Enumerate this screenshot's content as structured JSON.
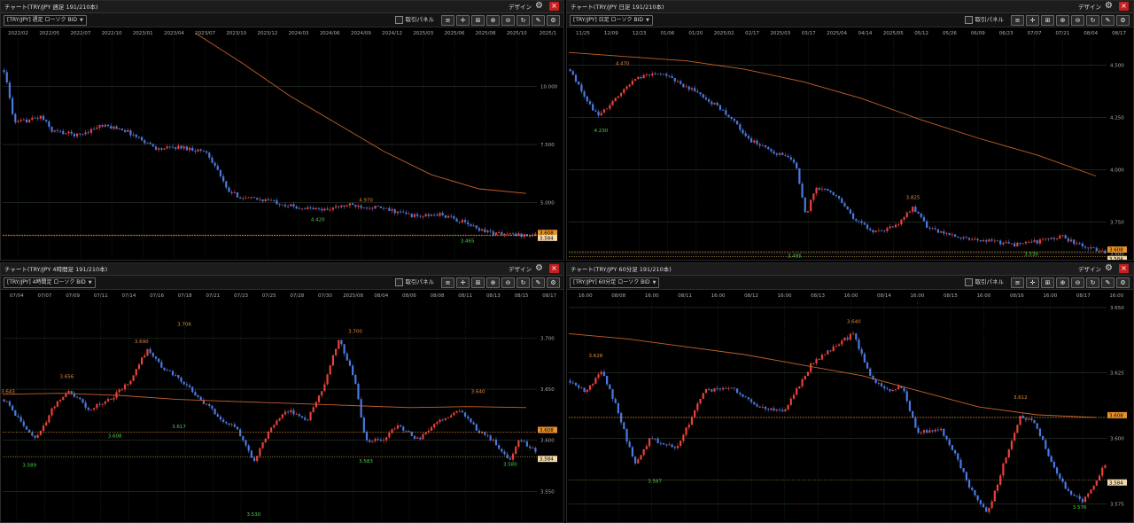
{
  "ui": {
    "design_label": "デザイン",
    "order_panel_label": "取引パネル",
    "close_glyph": "×",
    "caret_glyph": "▼",
    "colors": {
      "bull": "#e8403a",
      "bear": "#4a78e0",
      "ma": "#c8602a",
      "grid": "#1b3a1b",
      "ask_line": "#e8922a",
      "label_bg": "#e8922a",
      "close_button": "#c81e1e"
    }
  },
  "panels": [
    {
      "title": "チャート(TRY/JPY 週足 191/210本)",
      "symbol": "[TRY/JPY] 週足 ローソク BID",
      "chart_data": {
        "type": "candlestick",
        "x_ticks": [
          "2022/02",
          "2022/05",
          "2022/07",
          "2022/10",
          "2023/01",
          "2023/04",
          "2023/07",
          "2023/10",
          "2023/12",
          "2024/03",
          "2024/06",
          "2024/09",
          "2024/12",
          "2025/03",
          "2025/06",
          "2025/08",
          "2025/10",
          "2025/1"
        ],
        "y_ticks": [
          "10.000",
          "7.500",
          "5.000"
        ],
        "ylim": [
          2.55,
          12.0
        ],
        "annotations": [
          {
            "text": "4.970",
            "color": "orange"
          },
          {
            "text": "4.420",
            "color": "green"
          },
          {
            "text": "3.465",
            "color": "green"
          }
        ],
        "price_tags": [
          "3.608",
          "3.584"
        ],
        "price_levels": [
          3.608,
          3.584
        ],
        "path": [
          [
            0,
            10.7
          ],
          [
            0.02,
            8.4
          ],
          [
            0.07,
            8.7
          ],
          [
            0.09,
            8.1
          ],
          [
            0.14,
            7.9
          ],
          [
            0.18,
            8.3
          ],
          [
            0.22,
            8.2
          ],
          [
            0.26,
            7.7
          ],
          [
            0.29,
            7.3
          ],
          [
            0.33,
            7.4
          ],
          [
            0.38,
            7.2
          ],
          [
            0.4,
            6.5
          ],
          [
            0.42,
            5.5
          ],
          [
            0.45,
            5.2
          ],
          [
            0.5,
            5.1
          ],
          [
            0.55,
            4.8
          ],
          [
            0.6,
            4.7
          ],
          [
            0.65,
            4.9
          ],
          [
            0.7,
            4.8
          ],
          [
            0.74,
            4.6
          ],
          [
            0.78,
            4.4
          ],
          [
            0.82,
            4.5
          ],
          [
            0.86,
            4.2
          ],
          [
            0.89,
            3.9
          ],
          [
            0.92,
            3.7
          ],
          [
            0.96,
            3.62
          ],
          [
            1.0,
            3.6
          ]
        ],
        "ma": {
          "x0": 0.36,
          "x1": 0.98,
          "y": [
            12.3,
            11.0,
            9.6,
            8.4,
            7.2,
            6.2,
            5.6,
            5.4
          ]
        },
        "markers": [
          {
            "label": "4.970",
            "lx": 0.68,
            "ly": 5.05,
            "color": "orange"
          },
          {
            "label": "4.420",
            "lx": 0.59,
            "ly": 4.2,
            "color": "green"
          },
          {
            "label": "3.465",
            "lx": 0.87,
            "ly": 3.3,
            "color": "green"
          }
        ]
      }
    },
    {
      "title": "チャート(TRY/JPY 日足 191/210本)",
      "symbol": "[TRY/JPY] 日足 ローソク BID",
      "chart_data": {
        "type": "candlestick",
        "x_ticks": [
          "11/25",
          "12/09",
          "12/23",
          "01/06",
          "01/20",
          "2025/02",
          "02/17",
          "2025/03",
          "03/17",
          "2025/04",
          "04/14",
          "2025/05",
          "05/12",
          "05/26",
          "06/09",
          "06/23",
          "07/07",
          "07/21",
          "08/04",
          "08/17"
        ],
        "y_ticks": [
          "4.500",
          "4.250",
          "4.000",
          "3.750",
          "3.600"
        ],
        "ylim": [
          3.57,
          4.62
        ],
        "annotations": [
          {
            "text": "4.470",
            "color": "orange"
          },
          {
            "text": "4.230",
            "color": "green"
          },
          {
            "text": "3.825",
            "color": "orange"
          },
          {
            "text": "3.495",
            "color": "green"
          },
          {
            "text": "3.530",
            "color": "green"
          }
        ],
        "price_tags": [
          "3.608",
          "3.584"
        ],
        "price_levels": [
          3.608,
          3.584
        ],
        "path": [
          [
            0,
            4.48
          ],
          [
            0.02,
            4.38
          ],
          [
            0.05,
            4.26
          ],
          [
            0.08,
            4.32
          ],
          [
            0.12,
            4.44
          ],
          [
            0.17,
            4.46
          ],
          [
            0.2,
            4.42
          ],
          [
            0.25,
            4.35
          ],
          [
            0.3,
            4.25
          ],
          [
            0.33,
            4.15
          ],
          [
            0.37,
            4.1
          ],
          [
            0.4,
            4.06
          ],
          [
            0.42,
            4.04
          ],
          [
            0.44,
            3.78
          ],
          [
            0.46,
            3.92
          ],
          [
            0.5,
            3.88
          ],
          [
            0.53,
            3.76
          ],
          [
            0.57,
            3.7
          ],
          [
            0.61,
            3.73
          ],
          [
            0.64,
            3.82
          ],
          [
            0.67,
            3.72
          ],
          [
            0.72,
            3.68
          ],
          [
            0.78,
            3.66
          ],
          [
            0.83,
            3.64
          ],
          [
            0.88,
            3.66
          ],
          [
            0.92,
            3.68
          ],
          [
            0.96,
            3.63
          ],
          [
            1.0,
            3.61
          ]
        ],
        "ma": {
          "x0": 0.0,
          "x1": 0.98,
          "y": [
            4.56,
            4.54,
            4.52,
            4.48,
            4.42,
            4.34,
            4.24,
            4.15,
            4.07,
            3.97
          ]
        },
        "markers": [
          {
            "label": "4.470",
            "lx": 0.1,
            "ly": 4.5,
            "color": "orange"
          },
          {
            "label": "4.230",
            "lx": 0.06,
            "ly": 4.18,
            "color": "green"
          },
          {
            "label": "3.825",
            "lx": 0.64,
            "ly": 3.86,
            "color": "orange"
          },
          {
            "label": "3.495",
            "lx": 0.42,
            "ly": 3.58,
            "color": "green"
          },
          {
            "label": "3.530",
            "lx": 0.86,
            "ly": 3.59,
            "color": "green"
          }
        ]
      }
    },
    {
      "title": "チャート(TRY/JPY 4時間足 191/210本)",
      "symbol": "[TRY/JPY] 4時間足 ローソク BID",
      "chart_data": {
        "type": "candlestick",
        "x_ticks": [
          "07/04",
          "07/07",
          "07/09",
          "07/11",
          "07/14",
          "07/16",
          "07/18",
          "07/21",
          "07/23",
          "07/25",
          "07/28",
          "07/30",
          "2025/08",
          "08/04",
          "08/06",
          "08/08",
          "08/11",
          "08/13",
          "08/15",
          "08/17"
        ],
        "y_ticks": [
          "3.700",
          "3.650",
          "3.600",
          "3.550"
        ],
        "ylim": [
          3.52,
          3.735
        ],
        "annotations": [
          {
            "text": "3.706",
            "color": "orange"
          },
          {
            "text": "3.690",
            "color": "orange"
          },
          {
            "text": "3.700",
            "color": "orange"
          },
          {
            "text": "3.656",
            "color": "orange"
          },
          {
            "text": "3.640",
            "color": "orange"
          },
          {
            "text": "3.643",
            "color": "orange"
          },
          {
            "text": "3.617",
            "color": "green"
          },
          {
            "text": "3.608",
            "color": "green"
          },
          {
            "text": "3.589",
            "color": "green"
          },
          {
            "text": "3.583",
            "color": "green"
          },
          {
            "text": "3.580",
            "color": "green"
          },
          {
            "text": "3.530",
            "color": "green"
          }
        ],
        "price_tags": [
          "3.608",
          "3.584"
        ],
        "price_levels": [
          3.608,
          3.584
        ],
        "path": [
          [
            0,
            3.64
          ],
          [
            0.03,
            3.62
          ],
          [
            0.06,
            3.6
          ],
          [
            0.09,
            3.63
          ],
          [
            0.12,
            3.65
          ],
          [
            0.16,
            3.63
          ],
          [
            0.2,
            3.64
          ],
          [
            0.24,
            3.66
          ],
          [
            0.27,
            3.69
          ],
          [
            0.3,
            3.67
          ],
          [
            0.33,
            3.66
          ],
          [
            0.37,
            3.64
          ],
          [
            0.41,
            3.62
          ],
          [
            0.44,
            3.61
          ],
          [
            0.47,
            3.58
          ],
          [
            0.5,
            3.61
          ],
          [
            0.53,
            3.63
          ],
          [
            0.57,
            3.62
          ],
          [
            0.6,
            3.65
          ],
          [
            0.63,
            3.7
          ],
          [
            0.66,
            3.66
          ],
          [
            0.68,
            3.6
          ],
          [
            0.71,
            3.6
          ],
          [
            0.74,
            3.615
          ],
          [
            0.78,
            3.6
          ],
          [
            0.82,
            3.62
          ],
          [
            0.86,
            3.63
          ],
          [
            0.89,
            3.61
          ],
          [
            0.92,
            3.6
          ],
          [
            0.95,
            3.58
          ],
          [
            0.97,
            3.6
          ],
          [
            1.0,
            3.59
          ]
        ],
        "ma": {
          "x0": 0.0,
          "x1": 0.98,
          "y": [
            3.645,
            3.646,
            3.644,
            3.64,
            3.638,
            3.636,
            3.634,
            3.632,
            3.633,
            3.632
          ]
        },
        "markers": [
          {
            "label": "3.706",
            "lx": 0.34,
            "ly": 3.712,
            "color": "orange"
          },
          {
            "label": "3.690",
            "lx": 0.26,
            "ly": 3.695,
            "color": "orange"
          },
          {
            "label": "3.700",
            "lx": 0.66,
            "ly": 3.705,
            "color": "orange"
          },
          {
            "label": "3.656",
            "lx": 0.12,
            "ly": 3.661,
            "color": "orange"
          },
          {
            "label": "3.640",
            "lx": 0.89,
            "ly": 3.646,
            "color": "orange"
          },
          {
            "label": "3.643",
            "lx": 0.01,
            "ly": 3.646,
            "color": "orange"
          },
          {
            "label": "3.617",
            "lx": 0.33,
            "ly": 3.612,
            "color": "green"
          },
          {
            "label": "3.608",
            "lx": 0.21,
            "ly": 3.603,
            "color": "green"
          },
          {
            "label": "3.589",
            "lx": 0.05,
            "ly": 3.574,
            "color": "green"
          },
          {
            "label": "3.583",
            "lx": 0.68,
            "ly": 3.578,
            "color": "green"
          },
          {
            "label": "3.580",
            "lx": 0.95,
            "ly": 3.575,
            "color": "green"
          },
          {
            "label": "3.530",
            "lx": 0.47,
            "ly": 3.526,
            "color": "green"
          }
        ]
      }
    },
    {
      "title": "チャート(TRY/JPY 60分足 191/210本)",
      "symbol": "[TRY/JPY] 60分足 ローソク BID",
      "chart_data": {
        "type": "candlestick",
        "x_ticks": [
          "16:00",
          "08/08",
          "16:00",
          "08/11",
          "16:00",
          "08/12",
          "16:00",
          "08/13",
          "16:00",
          "08/14",
          "16:00",
          "08/15",
          "16:00",
          "08/16",
          "16:00",
          "08/17",
          "16:00"
        ],
        "y_ticks": [
          "3.650",
          "3.625",
          "3.600",
          "3.575"
        ],
        "ylim": [
          3.568,
          3.652
        ],
        "annotations": [
          {
            "text": "3.640",
            "color": "orange"
          },
          {
            "text": "3.628",
            "color": "orange"
          },
          {
            "text": "3.612",
            "color": "orange"
          },
          {
            "text": "3.587",
            "color": "green"
          },
          {
            "text": "3.576",
            "color": "green"
          },
          {
            "text": "3.569",
            "color": "green"
          }
        ],
        "price_tags": [
          "3.608",
          "3.584"
        ],
        "price_levels": [
          3.608,
          3.584
        ],
        "path": [
          [
            0,
            3.622
          ],
          [
            0.03,
            3.618
          ],
          [
            0.06,
            3.626
          ],
          [
            0.09,
            3.61
          ],
          [
            0.12,
            3.59
          ],
          [
            0.15,
            3.6
          ],
          [
            0.2,
            3.596
          ],
          [
            0.25,
            3.618
          ],
          [
            0.3,
            3.62
          ],
          [
            0.35,
            3.612
          ],
          [
            0.4,
            3.61
          ],
          [
            0.45,
            3.628
          ],
          [
            0.5,
            3.636
          ],
          [
            0.53,
            3.64
          ],
          [
            0.56,
            3.624
          ],
          [
            0.59,
            3.618
          ],
          [
            0.62,
            3.62
          ],
          [
            0.65,
            3.602
          ],
          [
            0.69,
            3.604
          ],
          [
            0.72,
            3.594
          ],
          [
            0.75,
            3.58
          ],
          [
            0.78,
            3.571
          ],
          [
            0.81,
            3.59
          ],
          [
            0.84,
            3.608
          ],
          [
            0.87,
            3.606
          ],
          [
            0.9,
            3.59
          ],
          [
            0.93,
            3.58
          ],
          [
            0.96,
            3.576
          ],
          [
            1.0,
            3.59
          ]
        ],
        "ma": {
          "x0": 0.0,
          "x1": 0.98,
          "y": [
            3.64,
            3.638,
            3.635,
            3.632,
            3.628,
            3.624,
            3.618,
            3.612,
            3.609,
            3.608
          ]
        },
        "markers": [
          {
            "label": "3.640",
            "lx": 0.53,
            "ly": 3.644,
            "color": "orange"
          },
          {
            "label": "3.628",
            "lx": 0.05,
            "ly": 3.631,
            "color": "orange"
          },
          {
            "label": "3.612",
            "lx": 0.84,
            "ly": 3.615,
            "color": "orange"
          },
          {
            "label": "3.587",
            "lx": 0.16,
            "ly": 3.583,
            "color": "green"
          },
          {
            "label": "3.576",
            "lx": 0.95,
            "ly": 3.573,
            "color": "green"
          },
          {
            "label": "3.569",
            "lx": 0.78,
            "ly": 3.566,
            "color": "green"
          }
        ]
      }
    }
  ]
}
